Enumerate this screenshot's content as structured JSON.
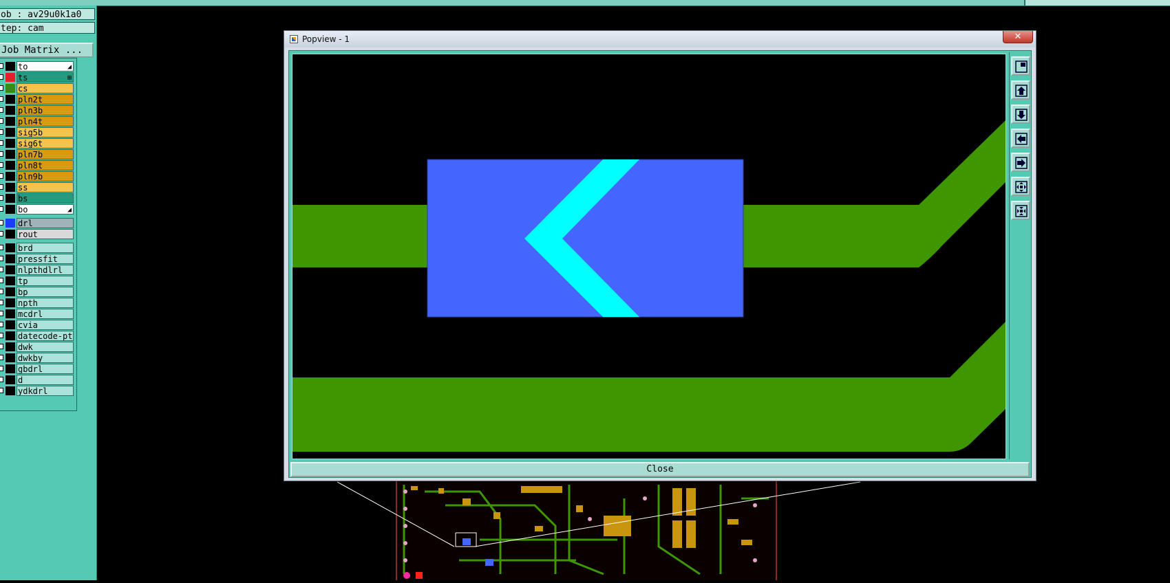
{
  "panel": {
    "job": "ob : av29u0k1a0",
    "step": "tep: cam",
    "job_matrix_button": "Job Matrix ..."
  },
  "layers": [
    {
      "name": "to",
      "fill": "#ffffff",
      "swatch": "#000000",
      "mark": "◢"
    },
    {
      "name": "ts",
      "fill": "#1f9d7e",
      "swatch": "#e0202a",
      "mark": "⊞",
      "active": true
    },
    {
      "name": "cs",
      "fill": "#f6c34a",
      "swatch": "#3a8a18"
    },
    {
      "name": "pln2t",
      "fill": "#d99a10",
      "swatch": "#000000"
    },
    {
      "name": "pln3b",
      "fill": "#d99a10",
      "swatch": "#000000"
    },
    {
      "name": "pln4t",
      "fill": "#d99a10",
      "swatch": "#000000"
    },
    {
      "name": "sig5b",
      "fill": "#f6c34a",
      "swatch": "#000000"
    },
    {
      "name": "sig6t",
      "fill": "#f6c34a",
      "swatch": "#000000"
    },
    {
      "name": "pln7b",
      "fill": "#d99a10",
      "swatch": "#000000"
    },
    {
      "name": "pln8t",
      "fill": "#d99a10",
      "swatch": "#000000"
    },
    {
      "name": "pln9b",
      "fill": "#d99a10",
      "swatch": "#000000"
    },
    {
      "name": "ss",
      "fill": "#f6c34a",
      "swatch": "#000000"
    },
    {
      "name": "bs",
      "fill": "#1f9d7e",
      "swatch": "#000000"
    },
    {
      "name": "bo",
      "fill": "#ffffff",
      "swatch": "#000000",
      "mark": "◢"
    },
    {
      "name": "drl",
      "fill": "#9fb3b8",
      "swatch": "#1a3cff",
      "gap": true
    },
    {
      "name": "rout",
      "fill": "#d9d9d9",
      "swatch": "#000000"
    },
    {
      "name": "brd",
      "fill": "#a9e2d8",
      "swatch": "#000000",
      "gap": true
    },
    {
      "name": "pressfit",
      "fill": "#a9e2d8",
      "swatch": "#000000"
    },
    {
      "name": "nlpthdlrl",
      "fill": "#a9e2d8",
      "swatch": "#000000"
    },
    {
      "name": "tp",
      "fill": "#a9e2d8",
      "swatch": "#000000"
    },
    {
      "name": "bp",
      "fill": "#a9e2d8",
      "swatch": "#000000"
    },
    {
      "name": "npth",
      "fill": "#a9e2d8",
      "swatch": "#000000"
    },
    {
      "name": "mcdrl",
      "fill": "#a9e2d8",
      "swatch": "#000000"
    },
    {
      "name": "cvia",
      "fill": "#a9e2d8",
      "swatch": "#000000"
    },
    {
      "name": "datecode-ptc",
      "fill": "#a9e2d8",
      "swatch": "#000000"
    },
    {
      "name": "dwk",
      "fill": "#a9e2d8",
      "swatch": "#000000"
    },
    {
      "name": "dwkby",
      "fill": "#a9e2d8",
      "swatch": "#000000"
    },
    {
      "name": "gbdrl",
      "fill": "#a9e2d8",
      "swatch": "#000000"
    },
    {
      "name": "d",
      "fill": "#a9e2d8",
      "swatch": "#000000"
    },
    {
      "name": "ydkdrl",
      "fill": "#a9e2d8",
      "swatch": "#000000"
    }
  ],
  "popup": {
    "title": "Popview - 1",
    "close_x": "✕",
    "close_label": "Close",
    "toolbar_icons": [
      "zoom-fit-icon",
      "page-up-icon",
      "page-down-icon",
      "page-left-icon",
      "page-right-icon",
      "zoom-out-icon",
      "zoom-in-icon"
    ]
  },
  "colors": {
    "trace_green": "#3e9600",
    "pad_blue": "#4466ff",
    "marker_cyan": "#00ffff",
    "panel_teal": "#55c9b3"
  }
}
